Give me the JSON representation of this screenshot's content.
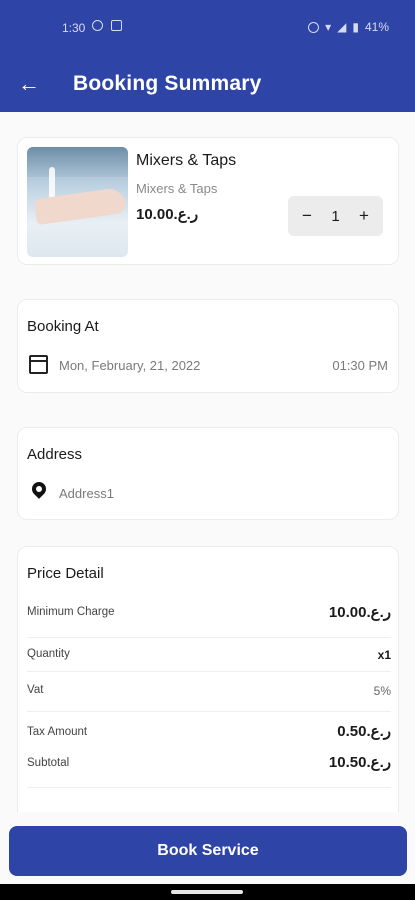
{
  "status_bar": {
    "time": "1:30",
    "battery": "41%"
  },
  "header": {
    "title": "Booking Summary"
  },
  "item": {
    "name": "Mixers & Taps",
    "subtitle": "Mixers & Taps",
    "price": "10.00.ر.ع",
    "quantity": "1",
    "decrement": "−",
    "increment": "+"
  },
  "booking": {
    "title": "Booking At",
    "date": "Mon, February, 21, 2022",
    "time": "01:30 PM"
  },
  "address": {
    "title": "Address",
    "value": "Address1"
  },
  "price_detail": {
    "title": "Price Detail",
    "rows": [
      {
        "label": "Minimum Charge",
        "value": "10.00.ر.ع"
      },
      {
        "label": "Quantity",
        "value": "x1"
      },
      {
        "label": "Vat",
        "value": "5%"
      },
      {
        "label": "Tax Amount",
        "value": "0.50.ر.ع"
      },
      {
        "label": "Subtotal",
        "value": "10.50.ر.ع"
      }
    ]
  },
  "footer": {
    "book_label": "Book Service"
  },
  "colors": {
    "primary": "#2e44a6"
  }
}
